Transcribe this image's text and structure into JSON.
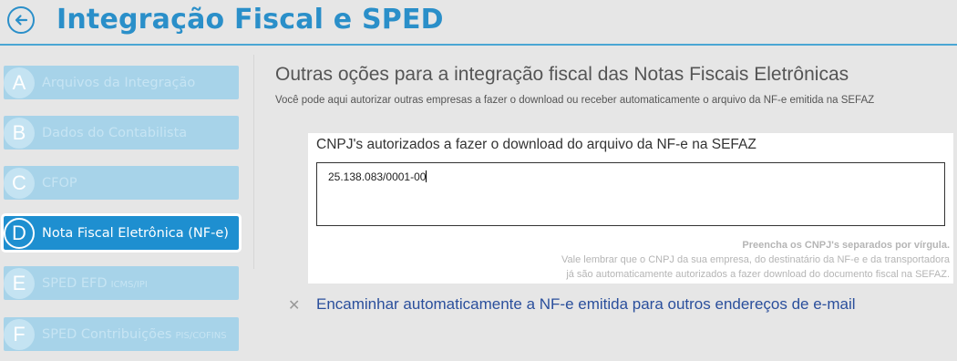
{
  "header": {
    "title": "Integração Fiscal e SPED",
    "back_icon": "arrow-left-circle-icon"
  },
  "sidebar": {
    "items": [
      {
        "letter": "A",
        "label": "Arquivos da Integração",
        "small": "",
        "active": false
      },
      {
        "letter": "B",
        "label": "Dados do Contabilista",
        "small": "",
        "active": false
      },
      {
        "letter": "C",
        "label": "CFOP",
        "small": "",
        "active": false
      },
      {
        "letter": "D",
        "label": "Nota Fiscal Eletrônica (NF-e)",
        "small": "",
        "active": true
      },
      {
        "letter": "E",
        "label": "SPED EFD",
        "small": "ICMS/IPI",
        "active": false
      },
      {
        "letter": "F",
        "label": "SPED Contribuições",
        "small": "PIS/COFINS",
        "active": false
      }
    ]
  },
  "main": {
    "title": "Outras oções para a integração fiscal das Notas Fiscais Eletrônicas",
    "subtitle": "Você pode aqui autorizar outras empresas a fazer o download ou receber automaticamente o arquivo da NF-e emitida na SEFAZ",
    "cnpj_panel": {
      "label": "CNPJ's autorizados a fazer o download do arquivo da NF-e na SEFAZ",
      "value": "25.138.083/0001-00",
      "hint_bold": "Preencha os CNPJ's separados por vírgula.",
      "hint_line1": "Vale lembrar que o CNPJ da sua empresa, do destinatário da NF-e e da transportadora",
      "hint_line2": "já são automaticamente autorizados a fazer download do documento fiscal na SEFAZ."
    },
    "email_option": {
      "icon": "close-icon",
      "label": "Encaminhar automaticamente a NF-e emitida para outros endereços de e-mail"
    }
  },
  "colors": {
    "accent": "#2a8fc9",
    "active_item": "#1e8fd0",
    "inactive_item": "#a7d3e9",
    "link": "#2a4f9c"
  }
}
